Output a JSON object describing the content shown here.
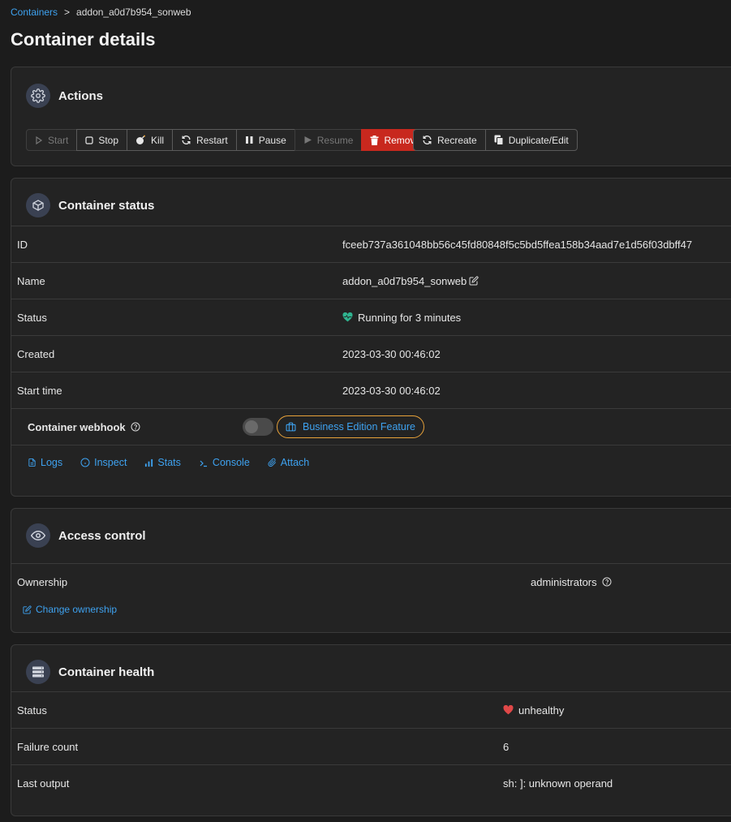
{
  "breadcrumb": {
    "root": "Containers",
    "separator": ">",
    "current": "addon_a0d7b954_sonweb"
  },
  "page_title": "Container details",
  "actions": {
    "title": "Actions",
    "buttons": {
      "start": "Start",
      "stop": "Stop",
      "kill": "Kill",
      "restart": "Restart",
      "pause": "Pause",
      "resume": "Resume",
      "remove": "Remove",
      "recreate": "Recreate",
      "duplicate": "Duplicate/Edit"
    }
  },
  "status": {
    "title": "Container status",
    "rows": {
      "id": {
        "label": "ID",
        "value": "fceeb737a361048bb56c45fd80848f5c5bd5ffea158b34aad7e1d56f03dbff47"
      },
      "name": {
        "label": "Name",
        "value": "addon_a0d7b954_sonweb"
      },
      "status": {
        "label": "Status",
        "value": "Running for 3 minutes"
      },
      "created": {
        "label": "Created",
        "value": "2023-03-30 00:46:02"
      },
      "start_time": {
        "label": "Start time",
        "value": "2023-03-30 00:46:02"
      }
    },
    "webhook": {
      "label": "Container webhook",
      "badge": "Business Edition Feature",
      "enabled": false
    },
    "links": {
      "logs": "Logs",
      "inspect": "Inspect",
      "stats": "Stats",
      "console": "Console",
      "attach": "Attach"
    }
  },
  "access": {
    "title": "Access control",
    "ownership_label": "Ownership",
    "ownership_value": "administrators",
    "change_link": "Change ownership"
  },
  "health": {
    "title": "Container health",
    "rows": {
      "status": {
        "label": "Status",
        "value": "unhealthy"
      },
      "failure": {
        "label": "Failure count",
        "value": "6"
      },
      "output": {
        "label": "Last output",
        "value": "sh: ]: unknown operand"
      }
    }
  },
  "colors": {
    "link": "#3ea2f0",
    "danger": "#c8281e",
    "running": "#2fb38f",
    "unhealthy": "#e04848",
    "badge_border": "#e8a23a"
  }
}
